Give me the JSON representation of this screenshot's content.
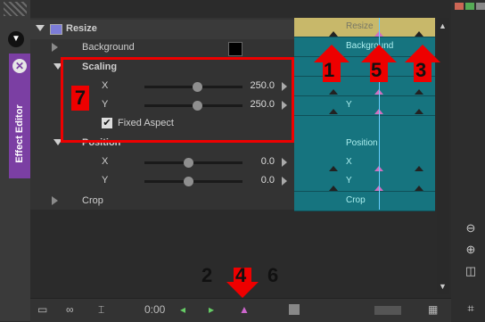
{
  "panel": {
    "tab_label": "Effect Editor"
  },
  "properties": {
    "resize": "Resize",
    "background": "Background",
    "scaling": "Scaling",
    "x_label": "X",
    "x_value": "250.0",
    "y_label": "Y",
    "y_value": "250.0",
    "fixed_aspect": "Fixed Aspect",
    "position": "Position",
    "pos_x_label": "X",
    "pos_x_value": "0.0",
    "pos_y_label": "Y",
    "pos_y_value": "0.0",
    "crop": "Crop"
  },
  "timeline": {
    "resize": "Resize",
    "background": "Background",
    "y": "Y",
    "position": "Position",
    "x": "X",
    "y2": "Y",
    "crop": "Crop"
  },
  "bottom": {
    "time": "0:00"
  },
  "annotations": {
    "n1": "1",
    "n2": "2",
    "n3": "3",
    "n4": "4",
    "n5": "5",
    "n6": "6",
    "n7": "7"
  },
  "colors": {
    "accent": "#7b3fa3",
    "track": "#16747f",
    "annotation": "#e00000"
  },
  "icons": [
    "zoom-out-icon",
    "zoom-in-icon",
    "split-view-icon",
    "graph-icon"
  ]
}
